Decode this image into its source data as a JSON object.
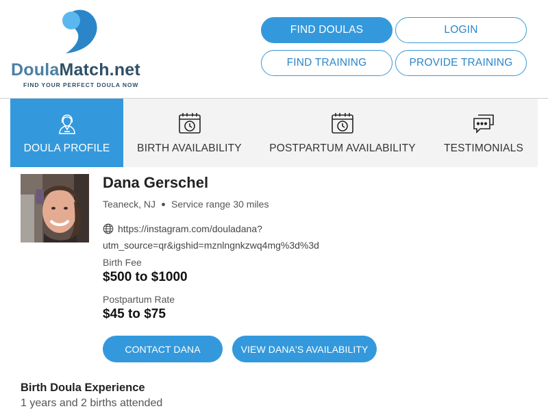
{
  "logo": {
    "word_part1": "Doula",
    "word_part2": "Match.net",
    "tagline": "FIND YOUR PERFECT DOULA NOW",
    "colors": {
      "dark_blue": "#2a86c8",
      "light_blue": "#5bb8ef"
    }
  },
  "nav": {
    "find_doulas": "FIND DOULAS",
    "login": "LOGIN",
    "find_training": "FIND TRAINING",
    "provide_training": "PROVIDE TRAINING"
  },
  "tabs": [
    {
      "label": "DOULA PROFILE",
      "icon": "doula-person-icon",
      "active": true
    },
    {
      "label": "BIRTH AVAILABILITY",
      "icon": "calendar-clock-icon",
      "active": false
    },
    {
      "label": "POSTPARTUM AVAILABILITY",
      "icon": "calendar-clock-icon",
      "active": false
    },
    {
      "label": "TESTIMONIALS",
      "icon": "chat-bubbles-icon",
      "active": false
    }
  ],
  "profile": {
    "name": "Dana Gerschel",
    "location": "Teaneck, NJ",
    "service_range": "Service range 30 miles",
    "website_line1": "https://instagram.com/douladana?",
    "website_line2": "utm_source=qr&igshid=mznlngnkzwq4mg%3d%3d",
    "birth_fee_label": "Birth Fee",
    "birth_fee": "$500 to $1000",
    "postpartum_rate_label": "Postpartum Rate",
    "postpartum_rate": "$45 to $75",
    "contact_button": "CONTACT DANA",
    "availability_button": "VIEW DANA'S AVAILABILITY"
  },
  "experience": {
    "title": "Birth Doula Experience",
    "summary": "1 years and 2 births attended"
  },
  "colors": {
    "accent": "#3499dc",
    "tab_bg": "#f3f3f3"
  }
}
